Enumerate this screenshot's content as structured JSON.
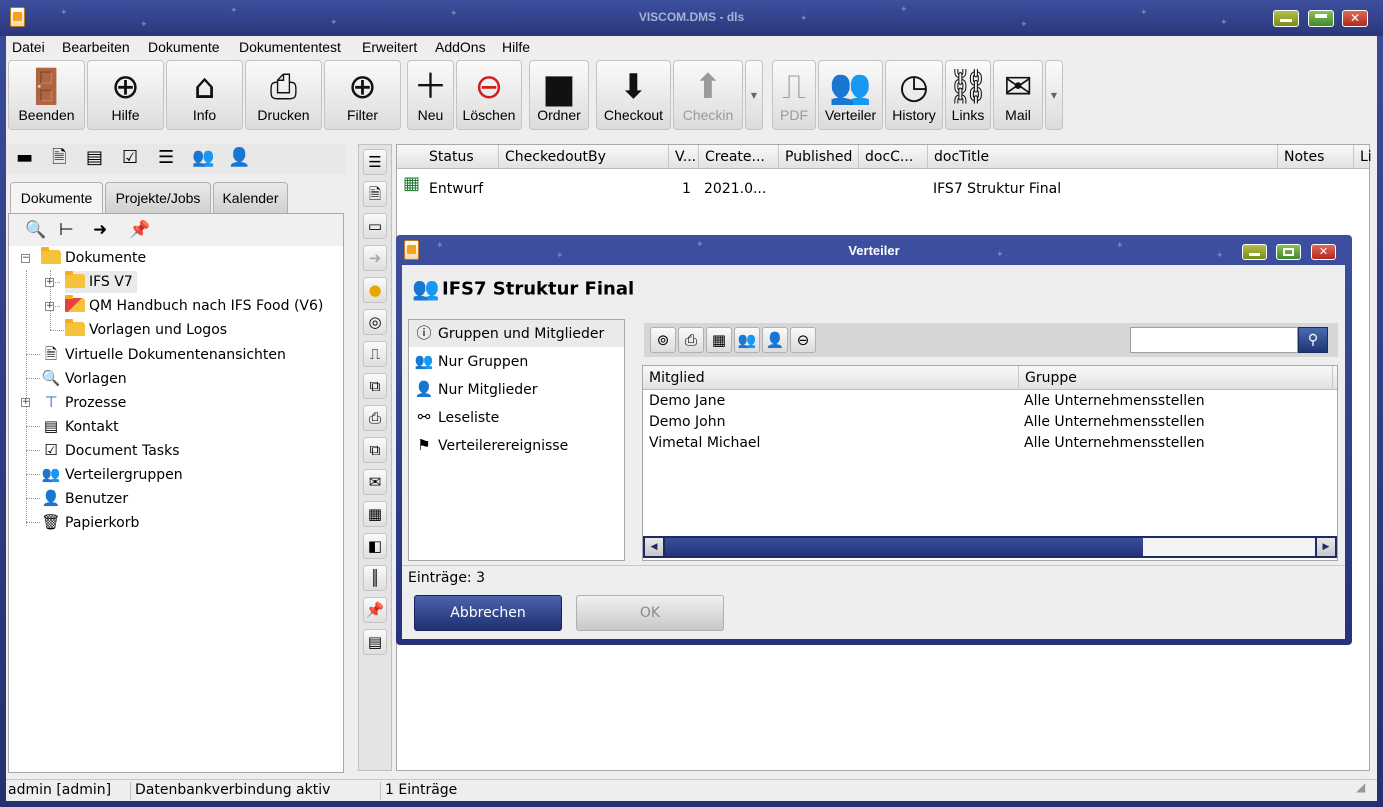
{
  "window": {
    "title": "VISCOM.DMS - dls"
  },
  "menu": [
    "Datei",
    "Bearbeiten",
    "Dokumente",
    "Dokumententest",
    "Erweitert",
    "AddOns",
    "Hilfe"
  ],
  "toolbar": {
    "beenden": "Beenden",
    "hilfe": "Hilfe",
    "info": "Info",
    "drucken": "Drucken",
    "filter": "Filter",
    "neu": "Neu",
    "loeschen": "Löschen",
    "ordner": "Ordner",
    "checkout": "Checkout",
    "checkin": "Checkin",
    "pdf": "PDF",
    "verteiler": "Verteiler",
    "history": "History",
    "links": "Links",
    "mail": "Mail"
  },
  "left_tabs": [
    "Dokumente",
    "Projekte/Jobs",
    "Kalender"
  ],
  "tree": [
    {
      "label": "Dokumente"
    },
    {
      "label": "IFS V7"
    },
    {
      "label": "QM Handbuch nach IFS Food (V6)"
    },
    {
      "label": "Vorlagen und Logos"
    },
    {
      "label": "Virtuelle Dokumentenansichten"
    },
    {
      "label": "Vorlagen"
    },
    {
      "label": "Prozesse"
    },
    {
      "label": "Kontakt"
    },
    {
      "label": "Document Tasks"
    },
    {
      "label": "Verteilergruppen"
    },
    {
      "label": "Benutzer"
    },
    {
      "label": "Papierkorb"
    }
  ],
  "doc_table": {
    "columns": [
      "Status",
      "CheckedoutBy",
      "V...",
      "Create...",
      "Published",
      "docC...",
      "docTitle",
      "Notes",
      "Li"
    ],
    "rows": [
      {
        "status": "Entwurf",
        "version": "1",
        "created": "2021.0...",
        "title": "IFS7 Struktur Final"
      }
    ]
  },
  "dialog": {
    "title": "Verteiler",
    "heading": "IFS7 Struktur Final",
    "nav": [
      "Gruppen und Mitglieder",
      "Nur Gruppen",
      "Nur Mitglieder",
      "Leseliste",
      "Verteilerereignisse"
    ],
    "search_value": "",
    "columns": [
      "Mitglied",
      "Gruppe"
    ],
    "rows": [
      {
        "member": "Demo Jane",
        "group": "Alle Unternehmensstellen"
      },
      {
        "member": "Demo John",
        "group": "Alle Unternehmensstellen"
      },
      {
        "member": "Vimetal Michael",
        "group": "Alle Unternehmensstellen"
      }
    ],
    "count_label": "Einträge: 3",
    "cancel": "Abbrechen",
    "ok": "OK"
  },
  "status": {
    "user": "admin [admin]",
    "db": "Datenbankverbindung aktiv",
    "entries": "1 Einträge"
  }
}
